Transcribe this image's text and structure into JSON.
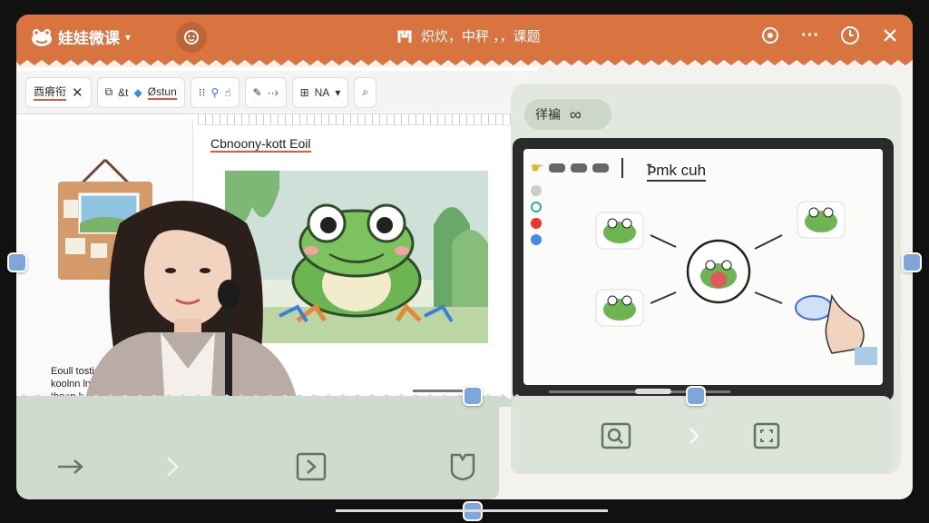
{
  "app": {
    "name": "娃娃微课",
    "title": "炽炊，中秤 ，，课题",
    "accent_color": "#d9733f"
  },
  "toolbar": {
    "group1_label": "酉瘠衔",
    "group2_label": "&t",
    "group2_label2": "Østun",
    "zoom_label": "NA"
  },
  "document": {
    "heading": "Cbnoony-kott Eoil",
    "side_text": [
      "Eoull tostich",
      "koolnn lnc",
      "theen h"
    ]
  },
  "tablet": {
    "pill_label": "徉褊",
    "screen_title": "Ꝥmk cuh"
  },
  "icons": {
    "logo": "frog-logo-icon",
    "home": "home-icon",
    "sync": "sync-icon",
    "more": "more-icon",
    "history": "clock-icon",
    "close": "close-icon"
  }
}
